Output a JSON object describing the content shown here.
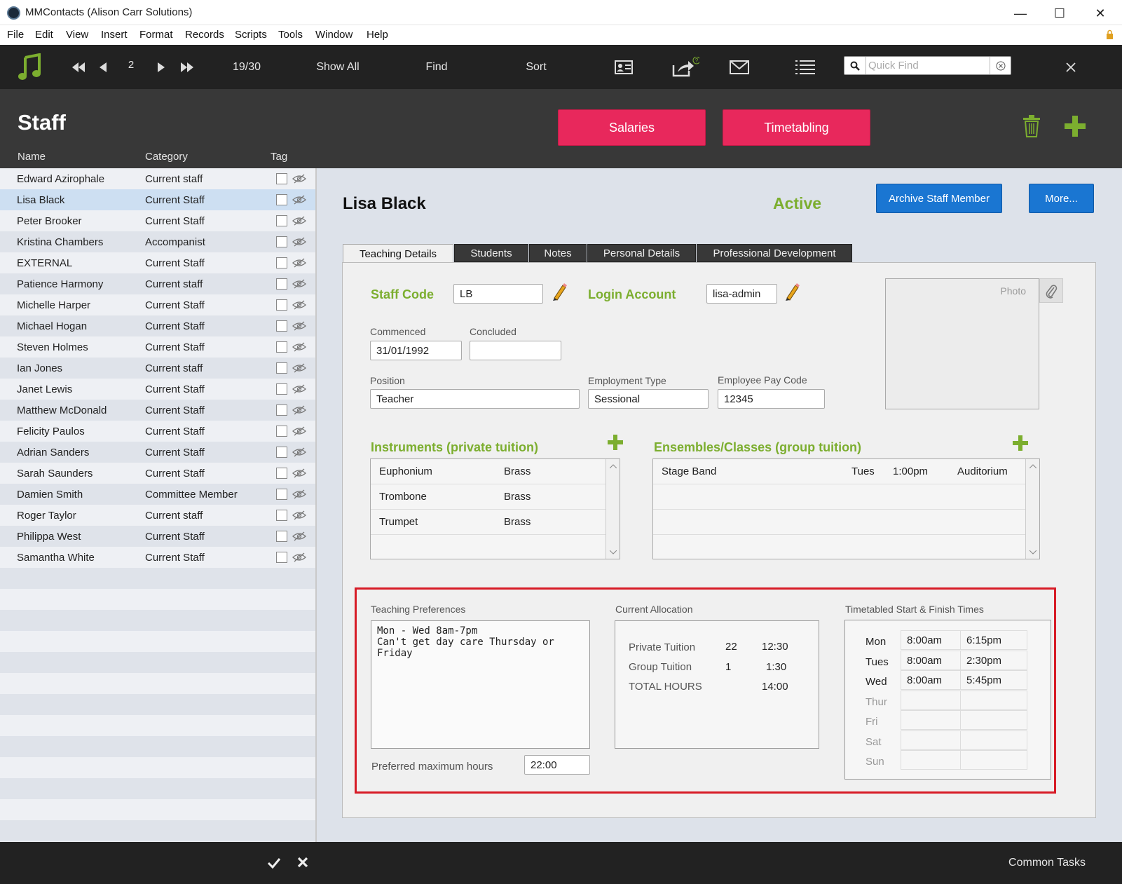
{
  "window": {
    "title": "MMContacts (Alison Carr Solutions)"
  },
  "menu": [
    "File",
    "Edit",
    "View",
    "Insert",
    "Format",
    "Records",
    "Scripts",
    "Tools",
    "Window",
    "Help"
  ],
  "toolbar": {
    "record_number": "2",
    "record_count": "19/30",
    "show_all": "Show All",
    "find": "Find",
    "sort": "Sort",
    "quick_find_placeholder": "Quick Find"
  },
  "header": {
    "title": "Staff",
    "salaries_label": "Salaries",
    "timetabling_label": "Timetabling",
    "col_name": "Name",
    "col_category": "Category",
    "col_tag": "Tag"
  },
  "staff_list": [
    {
      "name": "Edward Azirophale",
      "category": "Current staff"
    },
    {
      "name": "Lisa Black",
      "category": "Current Staff"
    },
    {
      "name": "Peter Brooker",
      "category": "Current Staff"
    },
    {
      "name": "Kristina Chambers",
      "category": "Accompanist"
    },
    {
      "name": " EXTERNAL",
      "category": "Current Staff"
    },
    {
      "name": "Patience Harmony",
      "category": "Current staff"
    },
    {
      "name": "Michelle Harper",
      "category": "Current Staff"
    },
    {
      "name": "Michael Hogan",
      "category": "Current Staff"
    },
    {
      "name": "Steven Holmes",
      "category": "Current Staff"
    },
    {
      "name": "Ian Jones",
      "category": "Current staff"
    },
    {
      "name": "Janet Lewis",
      "category": "Current Staff"
    },
    {
      "name": "Matthew McDonald",
      "category": "Current Staff"
    },
    {
      "name": "Felicity Paulos",
      "category": "Current Staff"
    },
    {
      "name": "Adrian Sanders",
      "category": "Current Staff"
    },
    {
      "name": "Sarah Saunders",
      "category": "Current Staff"
    },
    {
      "name": "Damien Smith",
      "category": "Committee Member"
    },
    {
      "name": "Roger Taylor",
      "category": "Current staff"
    },
    {
      "name": "Philippa West",
      "category": "Current Staff"
    },
    {
      "name": "Samantha White",
      "category": "Current Staff"
    }
  ],
  "detail": {
    "name": "Lisa Black",
    "status": "Active",
    "archive_label": "Archive Staff Member",
    "more_label": "More...",
    "tabs": [
      "Teaching Details",
      "Students",
      "Notes",
      "Personal Details",
      "Professional Development"
    ],
    "staff_code_label": "Staff Code",
    "staff_code": "LB",
    "login_account_label": "Login Account",
    "login_account": "lisa-admin",
    "commenced_label": "Commenced",
    "commenced": "31/01/1992",
    "concluded_label": "Concluded",
    "concluded": "",
    "position_label": "Position",
    "position": "Teacher",
    "employment_type_label": "Employment Type",
    "employment_type": "Sessional",
    "pay_code_label": "Employee Pay Code",
    "pay_code": "12345",
    "photo_label": "Photo",
    "instruments_label": "Instruments (private tuition)",
    "instruments": [
      {
        "name": "Euphonium",
        "family": "Brass"
      },
      {
        "name": "Trombone",
        "family": "Brass"
      },
      {
        "name": "Trumpet",
        "family": "Brass"
      }
    ],
    "ensembles_label": "Ensembles/Classes (group tuition)",
    "ensembles": [
      {
        "name": "Stage Band",
        "day": "Tues",
        "time": "1:00pm",
        "location": "Auditorium"
      }
    ],
    "teaching_prefs_label": "Teaching Preferences",
    "teaching_prefs_line1": "Mon - Wed 8am-7pm",
    "teaching_prefs_line2": "Can't get day care Thursday or Friday",
    "pref_max_hours_label": "Preferred maximum hours",
    "pref_max_hours": "22:00",
    "current_allocation_label": "Current Allocation",
    "allocation": [
      {
        "label": "Private Tuition",
        "count": "22",
        "hours": "12:30"
      },
      {
        "label": "Group Tuition",
        "count": "1",
        "hours": "1:30"
      },
      {
        "label": "TOTAL HOURS",
        "count": "",
        "hours": "14:00"
      }
    ],
    "timetable_label": "Timetabled Start & Finish Times",
    "timetable": [
      {
        "day": "Mon",
        "start": "8:00am",
        "finish": "6:15pm",
        "active": true
      },
      {
        "day": "Tues",
        "start": "8:00am",
        "finish": "2:30pm",
        "active": true
      },
      {
        "day": "Wed",
        "start": "8:00am",
        "finish": "5:45pm",
        "active": true
      },
      {
        "day": "Thur",
        "start": "",
        "finish": "",
        "active": false
      },
      {
        "day": "Fri",
        "start": "",
        "finish": "",
        "active": false
      },
      {
        "day": "Sat",
        "start": "",
        "finish": "",
        "active": false
      },
      {
        "day": "Sun",
        "start": "",
        "finish": "",
        "active": false
      }
    ]
  },
  "bottom": {
    "common_tasks": "Common Tasks"
  },
  "colors": {
    "accent_pink": "#e8285c",
    "accent_green": "#7cae2f",
    "accent_blue": "#1a76d2",
    "highlight_red": "#d71b26"
  }
}
